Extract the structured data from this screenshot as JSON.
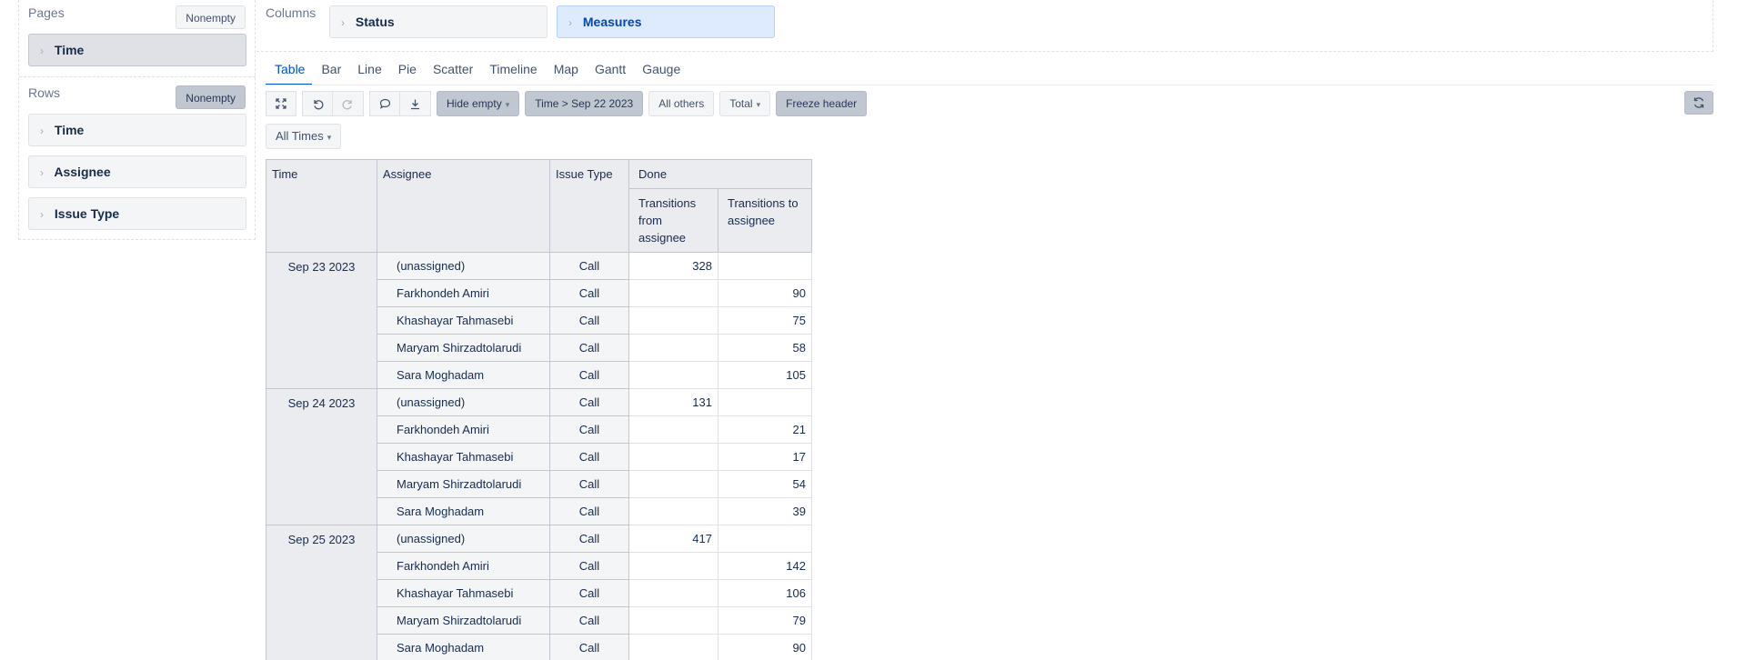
{
  "pages": {
    "header": "Pages",
    "nonempty_label": "Nonempty",
    "dimension": "Time"
  },
  "rows_section": {
    "header": "Rows",
    "nonempty_label": "Nonempty",
    "dimensions": [
      "Time",
      "Assignee",
      "Issue Type"
    ]
  },
  "columns_section": {
    "header": "Columns",
    "dimensions": [
      "Status",
      "Measures"
    ]
  },
  "tabs": [
    "Table",
    "Bar",
    "Line",
    "Pie",
    "Scatter",
    "Timeline",
    "Map",
    "Gantt",
    "Gauge"
  ],
  "active_tab": "Table",
  "toolbar": {
    "hide_empty": "Hide empty",
    "time_filter": "Time > Sep 22 2023",
    "all_others": "All others",
    "total": "Total",
    "freeze_header": "Freeze header",
    "icons": [
      "expand-icon",
      "undo-icon",
      "redo-icon",
      "comment-icon",
      "export-icon",
      "refresh-icon"
    ]
  },
  "time_filter_dropdown": "All Times",
  "table": {
    "headers": {
      "time": "Time",
      "assignee": "Assignee",
      "issue_type": "Issue Type",
      "status_group": "Done",
      "measure_1": "Transitions from assignee",
      "measure_2": "Transitions to assignee"
    },
    "groups": [
      {
        "date": "Sep 23 2023",
        "rows": [
          {
            "assignee": "(unassigned)",
            "issue_type": "Call",
            "from": "328",
            "to": ""
          },
          {
            "assignee": "Farkhondeh Amiri",
            "issue_type": "Call",
            "from": "",
            "to": "90"
          },
          {
            "assignee": "Khashayar Tahmasebi",
            "issue_type": "Call",
            "from": "",
            "to": "75"
          },
          {
            "assignee": "Maryam Shirzadtolarudi",
            "issue_type": "Call",
            "from": "",
            "to": "58"
          },
          {
            "assignee": "Sara Moghadam",
            "issue_type": "Call",
            "from": "",
            "to": "105"
          }
        ]
      },
      {
        "date": "Sep 24 2023",
        "rows": [
          {
            "assignee": "(unassigned)",
            "issue_type": "Call",
            "from": "131",
            "to": ""
          },
          {
            "assignee": "Farkhondeh Amiri",
            "issue_type": "Call",
            "from": "",
            "to": "21"
          },
          {
            "assignee": "Khashayar Tahmasebi",
            "issue_type": "Call",
            "from": "",
            "to": "17"
          },
          {
            "assignee": "Maryam Shirzadtolarudi",
            "issue_type": "Call",
            "from": "",
            "to": "54"
          },
          {
            "assignee": "Sara Moghadam",
            "issue_type": "Call",
            "from": "",
            "to": "39"
          }
        ]
      },
      {
        "date": "Sep 25 2023",
        "rows": [
          {
            "assignee": "(unassigned)",
            "issue_type": "Call",
            "from": "417",
            "to": ""
          },
          {
            "assignee": "Farkhondeh Amiri",
            "issue_type": "Call",
            "from": "",
            "to": "142"
          },
          {
            "assignee": "Khashayar Tahmasebi",
            "issue_type": "Call",
            "from": "",
            "to": "106"
          },
          {
            "assignee": "Maryam Shirzadtolarudi",
            "issue_type": "Call",
            "from": "",
            "to": "79"
          },
          {
            "assignee": "Sara Moghadam",
            "issue_type": "Call",
            "from": "",
            "to": "90"
          }
        ]
      }
    ]
  }
}
